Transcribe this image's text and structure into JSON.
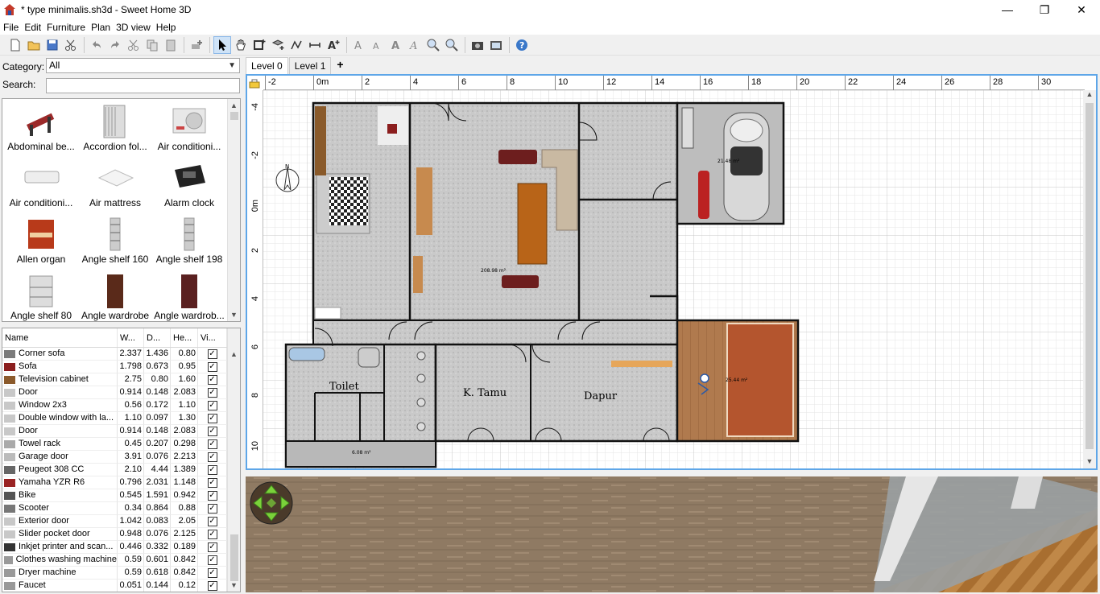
{
  "window": {
    "title": "* type minimalis.sh3d - Sweet Home 3D",
    "minimize": "—",
    "maximize": "❐",
    "close": "✕"
  },
  "menu": [
    "File",
    "Edit",
    "Furniture",
    "Plan",
    "3D view",
    "Help"
  ],
  "catalog": {
    "category_label": "Category:",
    "category_value": "All",
    "search_label": "Search:",
    "search_value": "",
    "items": [
      {
        "label": "Abdominal be...",
        "icon": "bench-icon"
      },
      {
        "label": "Accordion fol...",
        "icon": "accordion-door-icon"
      },
      {
        "label": "Air conditioni...",
        "icon": "air-conditioner-icon"
      },
      {
        "label": "Air conditioni...",
        "icon": "air-conditioner-indoor-icon"
      },
      {
        "label": "Air mattress",
        "icon": "mattress-icon"
      },
      {
        "label": "Alarm clock",
        "icon": "alarm-clock-icon"
      },
      {
        "label": "Allen organ",
        "icon": "organ-icon"
      },
      {
        "label": "Angle shelf 160",
        "icon": "shelf-icon"
      },
      {
        "label": "Angle shelf 198",
        "icon": "shelf-icon"
      },
      {
        "label": "Angle shelf 80",
        "icon": "shelf-icon"
      },
      {
        "label": "Angle wardrobe",
        "icon": "wardrobe-icon"
      },
      {
        "label": "Angle wardrob...",
        "icon": "wardrobe-icon"
      }
    ]
  },
  "furniture_table": {
    "headers": [
      "Name",
      "W...",
      "D...",
      "He...",
      "Vi..."
    ],
    "rows": [
      {
        "name": "Corner sofa",
        "w": "2.337",
        "d": "1.436",
        "h": "0.80",
        "visible": true,
        "color": "#7a7a7a"
      },
      {
        "name": "Sofa",
        "w": "1.798",
        "d": "0.673",
        "h": "0.95",
        "visible": true,
        "color": "#8b1e1e"
      },
      {
        "name": "Television cabinet",
        "w": "2.75",
        "d": "0.80",
        "h": "1.60",
        "visible": true,
        "color": "#8b5a2b"
      },
      {
        "name": "Door",
        "w": "0.914",
        "d": "0.148",
        "h": "2.083",
        "visible": true,
        "color": "#c8c8c8"
      },
      {
        "name": "Window 2x3",
        "w": "0.56",
        "d": "0.172",
        "h": "1.10",
        "visible": true,
        "color": "#c8c8c8"
      },
      {
        "name": "Double window with la...",
        "w": "1.10",
        "d": "0.097",
        "h": "1.30",
        "visible": true,
        "color": "#c8c8c8"
      },
      {
        "name": "Door",
        "w": "0.914",
        "d": "0.148",
        "h": "2.083",
        "visible": true,
        "color": "#c8c8c8"
      },
      {
        "name": "Towel rack",
        "w": "0.45",
        "d": "0.207",
        "h": "0.298",
        "visible": true,
        "color": "#aaaaaa"
      },
      {
        "name": "Garage door",
        "w": "3.91",
        "d": "0.076",
        "h": "2.213",
        "visible": true,
        "color": "#bbbbbb"
      },
      {
        "name": "Peugeot 308 CC",
        "w": "2.10",
        "d": "4.44",
        "h": "1.389",
        "visible": true,
        "color": "#666666"
      },
      {
        "name": "Yamaha YZR R6",
        "w": "0.796",
        "d": "2.031",
        "h": "1.148",
        "visible": true,
        "color": "#992222"
      },
      {
        "name": "Bike",
        "w": "0.545",
        "d": "1.591",
        "h": "0.942",
        "visible": true,
        "color": "#555555"
      },
      {
        "name": "Scooter",
        "w": "0.34",
        "d": "0.864",
        "h": "0.88",
        "visible": true,
        "color": "#777777"
      },
      {
        "name": "Exterior door",
        "w": "1.042",
        "d": "0.083",
        "h": "2.05",
        "visible": true,
        "color": "#c8c8c8"
      },
      {
        "name": "Slider pocket door",
        "w": "0.948",
        "d": "0.076",
        "h": "2.125",
        "visible": true,
        "color": "#c8c8c8"
      },
      {
        "name": "Inkjet printer and scan...",
        "w": "0.446",
        "d": "0.332",
        "h": "0.189",
        "visible": true,
        "color": "#333333"
      },
      {
        "name": "Clothes washing machine",
        "w": "0.59",
        "d": "0.601",
        "h": "0.842",
        "visible": true,
        "color": "#999999"
      },
      {
        "name": "Dryer machine",
        "w": "0.59",
        "d": "0.618",
        "h": "0.842",
        "visible": true,
        "color": "#999999"
      },
      {
        "name": "Faucet",
        "w": "0.051",
        "d": "0.144",
        "h": "0.12",
        "visible": true,
        "color": "#999999"
      }
    ]
  },
  "plan": {
    "tabs": [
      "Level 0",
      "Level 1"
    ],
    "add_tab": "+",
    "ruler_x": [
      "-2",
      "0m",
      "2",
      "4",
      "6",
      "8",
      "10",
      "12",
      "14",
      "16",
      "18",
      "20",
      "22",
      "24",
      "26",
      "28",
      "30"
    ],
    "ruler_y": [
      "-4",
      "-2",
      "0m",
      "2",
      "4",
      "6",
      "8",
      "10"
    ],
    "room_labels": {
      "toilet": "Toilet",
      "k_tamu": "K. Tamu",
      "dapur": "Dapur",
      "area_main": "208.98 m²",
      "area_bottom": "6.08 m²",
      "area_right": "25.44 m²",
      "area_garage": "21.48 m²",
      "compass": "N"
    }
  },
  "colors": {
    "selection_border": "#5ea6e8",
    "wall": "#1a1a1a",
    "floor_tile": "#cfcfcf",
    "wood_floor": "#b0774a",
    "grid_line": "#dcdcdc"
  }
}
